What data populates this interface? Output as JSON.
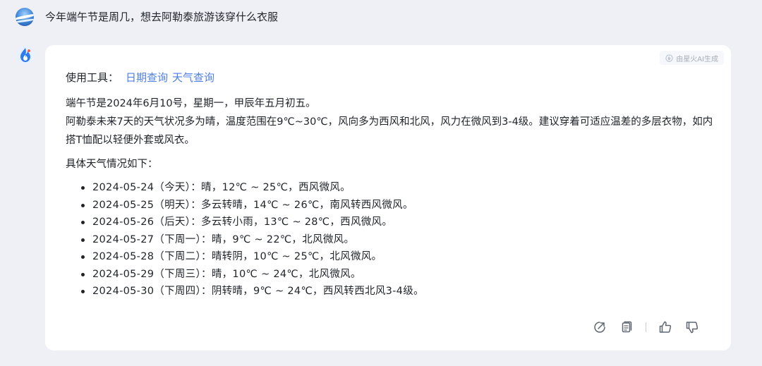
{
  "user": {
    "question": "今年端午节是周几，想去阿勒泰旅游该穿什么衣服"
  },
  "answer": {
    "badge": "由星火AI生成",
    "tools_label": "使用工具：",
    "tools": [
      "日期查询",
      "天气查询"
    ],
    "paragraph1": "端午节是2024年6月10号，星期一，甲辰年五月初五。",
    "paragraph2": "阿勒泰未来7天的天气状况多为晴，温度范围在9℃~30℃，风向多为西风和北风，风力在微风到3-4级。建议穿着可适应温差的多层衣物，如内搭T恤配以轻便外套或风衣。",
    "list_intro": "具体天气情况如下：",
    "forecast": [
      "2024-05-24（今天）：晴，12℃ ~ 25℃，西风微风。",
      "2024-05-25（明天）：多云转晴，14℃ ~ 26℃，南风转西风微风。",
      "2024-05-26（后天）：多云转小雨，13℃ ~ 28℃，西风微风。",
      "2024-05-27（下周一）：晴，9℃ ~ 22℃，北风微风。",
      "2024-05-28（下周二）：晴转阴，10℃ ~ 25℃，北风微风。",
      "2024-05-29（下周三）：晴，10℃ ~ 24℃，北风微风。",
      "2024-05-30（下周四）：阴转晴，9℃ ~ 24℃，西风转西北风3-4级。"
    ]
  },
  "icons": {
    "user_avatar": "user-avatar",
    "bot_avatar": "spark-flame-icon",
    "badge_icon": "spark-small-icon",
    "actions": [
      "share-icon",
      "copy-icon",
      "thumbs-up-icon",
      "thumbs-down-icon"
    ]
  },
  "colors": {
    "link": "#4f7fe6",
    "background": "#eef0f6",
    "card": "#ffffff",
    "bot_brand": "#2e7bf2"
  }
}
